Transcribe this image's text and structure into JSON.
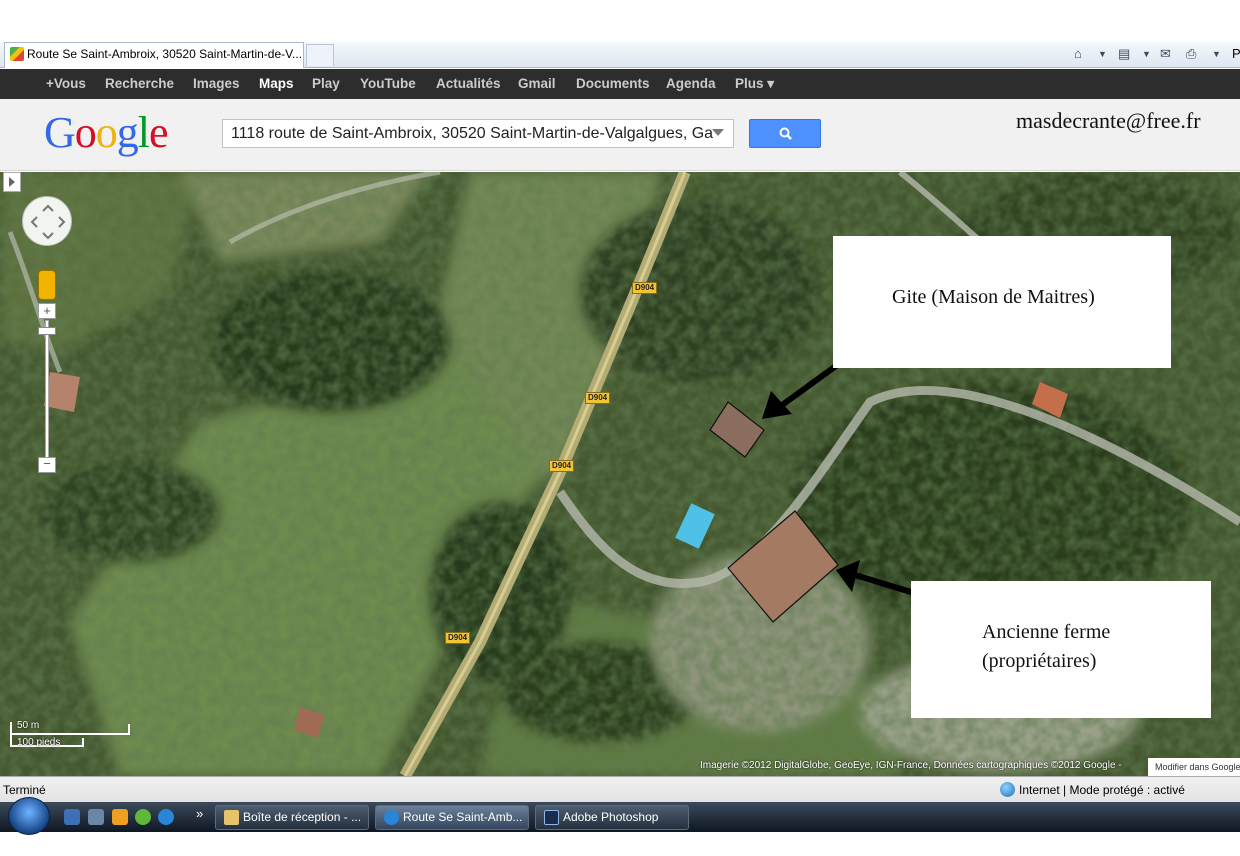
{
  "browser": {
    "tab_title": "Route Se Saint-Ambroix, 30520 Saint-Martin-de-V...",
    "cmd_partial": "P"
  },
  "google_bar": {
    "items": [
      "+Vous",
      "Recherche",
      "Images",
      "Maps",
      "Play",
      "YouTube",
      "Actualités",
      "Gmail",
      "Documents",
      "Agenda",
      "Plus ▾"
    ],
    "active": "Maps"
  },
  "header": {
    "logo_letters": [
      "G",
      "o",
      "o",
      "g",
      "l",
      "e"
    ],
    "logo_colors": [
      "#3369e8",
      "#d50f25",
      "#eeb211",
      "#3369e8",
      "#009925",
      "#d50f25"
    ],
    "search_value": "1118 route de Saint-Ambroix, 30520 Saint-Martin-de-Valgalgues, Ga",
    "email": "masdecrante@free.fr"
  },
  "map": {
    "road_labels": [
      "D904",
      "D904",
      "D904",
      "D904"
    ],
    "callouts": {
      "gite": "Gite (Maison de Maitres)",
      "ferme_line1": "Ancienne ferme",
      "ferme_line2": "(propriétaires)"
    },
    "scale_metric": "50 m",
    "scale_imperial": "100 pieds",
    "copyright": "Imagerie ©2012 DigitalGlobe, GeoEye, IGN-France, Données cartographiques ©2012 Google -",
    "modify_link": "Modifier dans Google"
  },
  "status_bar": {
    "left": "Terminé",
    "zone": "Internet | Mode protégé : activé"
  },
  "taskbar": {
    "tasks": [
      "Boîte de réception - ...",
      "Route Se Saint-Amb...",
      "Adobe Photoshop"
    ],
    "overflow": "»"
  }
}
